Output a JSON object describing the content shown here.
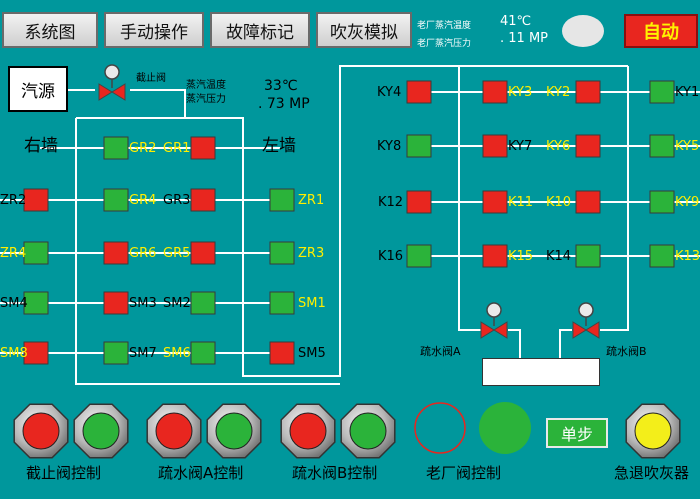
{
  "tabs": [
    "系统图",
    "手动操作",
    "故障标记",
    "吹灰模拟"
  ],
  "header": {
    "temp_label": "老厂蒸汽温度",
    "press_label": "老厂蒸汽压力",
    "temp_value": "41℃",
    "press_value": ". 11 MP",
    "mode": "自动"
  },
  "source": {
    "label": "汽源",
    "valve_label": "截止阀",
    "temp_label": "蒸汽温度",
    "press_label": "蒸汽压力",
    "temp_value": "33℃",
    "press_value": ". 73 MP"
  },
  "walls": {
    "right": "右墙",
    "left": "左墙"
  },
  "labels": {
    "gr2": "GR2",
    "gr1": "GR1",
    "zr2": "ZR2",
    "gr4": "GR4",
    "gr3": "GR3",
    "zr1": "ZR1",
    "zr4": "ZR4",
    "gr6": "GR6",
    "gr5": "GR5",
    "zr3": "ZR3",
    "sm4": "SM4",
    "sm3": "SM3",
    "sm2": "SM2",
    "sm1": "SM1",
    "sm8": "SM8",
    "sm7": "SM7",
    "sm6": "SM6",
    "sm5": "SM5",
    "ky4": "KY4",
    "ky3": "KY3",
    "ky2": "KY2",
    "ky1": "KY1",
    "ky8": "KY8",
    "ky7": "KY7",
    "ky6": "KY6",
    "ky5": "KY5",
    "k12": "K12",
    "k11": "K11",
    "k10": "K10",
    "k9": "KY9",
    "k16": "K16",
    "k15": "K15",
    "k14": "K14",
    "k13": "K13"
  },
  "drain": {
    "a": "疏水阀A",
    "b": "疏水阀B"
  },
  "controls": {
    "stop_valve": "截止阀控制",
    "drain_a": "疏水阀A控制",
    "drain_b": "疏水阀B控制",
    "old_plant": "老厂阀控制",
    "single_step": "单步",
    "retract": "急退吹灰器"
  },
  "colors": {
    "on": "#2bb33a",
    "off": "#e8261f",
    "background": "#00979c",
    "pipe": "#ffffff"
  }
}
